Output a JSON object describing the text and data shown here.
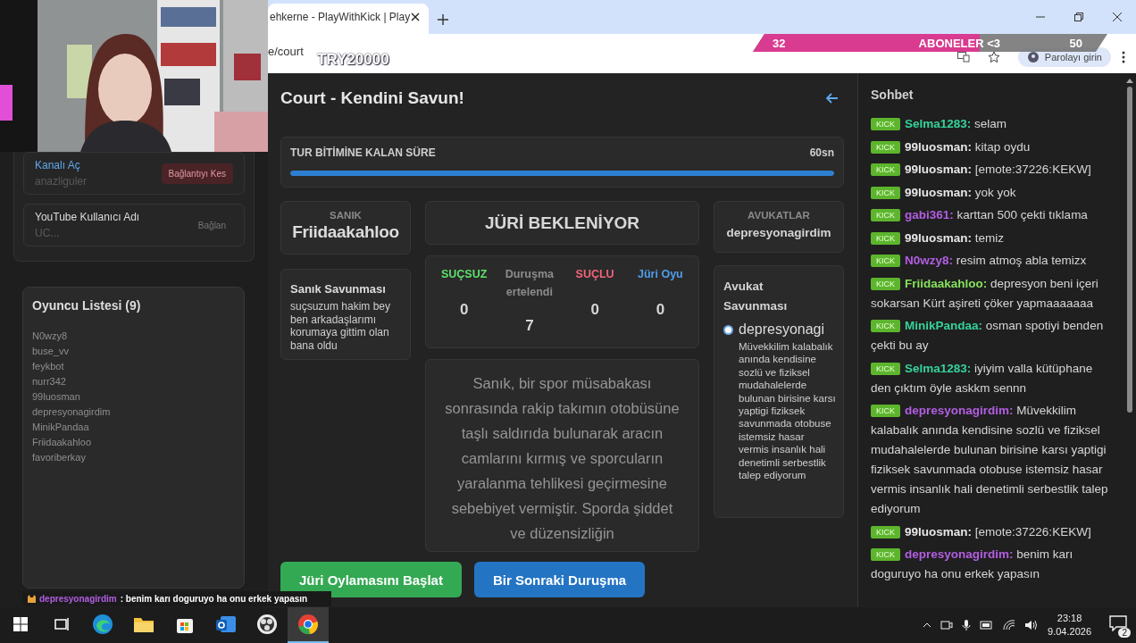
{
  "stream_overlay": {
    "goal": {
      "current": "32",
      "label": "ABONELER <3",
      "target": "50",
      "level": 0.64
    },
    "ticker_text": "TRY20000",
    "chat_toast": {
      "user": "depresyonagirdim",
      "text": ": benim karı doguruyo ha onu erkek yapasın"
    }
  },
  "browser": {
    "tab_title": "ehkerne - PlayWithKick | Play",
    "address": "e/court",
    "password_chip": "Parolayı girin"
  },
  "sidebar": {
    "accounts": [
      {
        "title": "Kanalı Aç",
        "kind": "link",
        "value": "anazliguler",
        "action": "Bağlantıyı Kes",
        "connected": true
      },
      {
        "title": "YouTube Kullanıcı Adı",
        "kind": "label",
        "value": "UC...",
        "action": "Bağlan",
        "connected": false
      }
    ],
    "players": {
      "title": "Oyuncu Listesi (9)",
      "names": [
        "N0wzy8",
        "buse_vv",
        "feykbot",
        "nurr342",
        "99luosman",
        "depresyonagirdim",
        "MinikPandaa",
        "Friidaakahloo",
        "favoriberkay"
      ]
    }
  },
  "court": {
    "title": "Court - Kendini Savun!",
    "timer": {
      "label": "TUR BİTİMİNE KALAN SÜRE",
      "value": "60sn",
      "level": 1
    },
    "defendant": {
      "label": "SANIK",
      "name": "Friidaakahloo"
    },
    "defendant_defense": {
      "title": "Sanık Savunması",
      "text": "suçsuzum hakim bey ben arkadaşlarımı korumaya gittim olan bana oldu"
    },
    "status": "JÜRİ BEKLENİYOR",
    "votes": [
      {
        "label": "SUÇSUZ",
        "count": "0",
        "color": "#5ee06a"
      },
      {
        "label": "Duruşma ertelendi",
        "count": "7",
        "color": "#8c8c8c"
      },
      {
        "label": "SUÇLU",
        "count": "0",
        "color": "#f2647a"
      },
      {
        "label": "Jüri Oyu",
        "count": "0",
        "color": "#4f9fea"
      }
    ],
    "case_text": "Sanık, bir spor müsabakası sonrasında rakip takımın otobüsüne taşlı saldırıda bulunarak aracın camlarını kırmış ve sporcuların yaralanma tehlikesi geçirmesine sebebiyet vermiştir. Sporda şiddet ve düzensizliğin",
    "lawyers": {
      "label": "AVUKATLAR",
      "name": "depresyonagirdim"
    },
    "lawyer_defense": {
      "title": "Avukat Savunması",
      "entries": [
        {
          "name": "depresyonagi",
          "text": "Müvekkilim kalabalık anında kendisine sozlü ve fiziksel mudahalelerde bulunan birisine karsı yaptigi fiziksek savunmada otobuse istemsiz hasar vermis insanlık hali denetimli serbestlik talep ediyorum",
          "selected": true
        }
      ]
    },
    "buttons": [
      {
        "label": "Jüri Oylamasını Başlat",
        "kind": "green"
      },
      {
        "label": "Bir Sonraki Duruşma",
        "kind": "blue"
      }
    ]
  },
  "chat": {
    "title": "Sohbet",
    "messages": [
      {
        "badge": "KICK",
        "user": "Selma1283:",
        "color": "#35d39a",
        "text": "selam"
      },
      {
        "badge": "KICK",
        "user": "99luosman:",
        "color": "#e6e6e6",
        "text": "kitap oydu"
      },
      {
        "badge": "KICK",
        "user": "99luosman:",
        "color": "#e6e6e6",
        "text": "[emote:37226:KEKW]"
      },
      {
        "badge": "KICK",
        "user": "99luosman:",
        "color": "#e6e6e6",
        "text": "yok yok"
      },
      {
        "badge": "KICK",
        "user": "gabi361:",
        "color": "#b35ee3",
        "text": "karttan 500 çekti tıklama"
      },
      {
        "badge": "KICK",
        "user": "99luosman:",
        "color": "#e6e6e6",
        "text": "temiz"
      },
      {
        "badge": "KICK",
        "user": "N0wzy8:",
        "color": "#b35ee3",
        "text": "resim atmoş abla temizx"
      },
      {
        "badge": "KICK",
        "user": "Friidaakahloo:",
        "color": "#86e05c",
        "text": "depresyon beni içeri sokarsan Kürt aşireti çöker yapmaaaaaaa"
      },
      {
        "badge": "KICK",
        "user": "MinikPandaa:",
        "color": "#35d39a",
        "text": "osman spotiyi benden çekti bu ay"
      },
      {
        "badge": "KICK",
        "user": "Selma1283:",
        "color": "#35d39a",
        "text": "iyiyim valla kütüphane den çıktım öyle askkm sennn"
      },
      {
        "badge": "KICK",
        "user": "depresyonagirdim:",
        "color": "#b35ee3",
        "text": "Müvekkilim kalabalık anında kendisine sozlü ve fiziksel mudahalelerde bulunan birisine karsı yaptigi fiziksek savunmada otobuse istemsiz hasar vermis insanlık hali denetimli serbestlik talep ediyorum"
      },
      {
        "badge": "KICK",
        "user": "99luosman:",
        "color": "#e6e6e6",
        "text": "[emote:37226:KEKW]"
      },
      {
        "badge": "KICK",
        "user": "depresyonagirdim:",
        "color": "#b35ee3",
        "text": "benim karı doguruyo ha onu erkek yapasın"
      }
    ]
  },
  "taskbar": {
    "apps": [
      {
        "kind": "start",
        "active": false
      },
      {
        "kind": "taskview",
        "active": false
      },
      {
        "kind": "edge",
        "active": false
      },
      {
        "kind": "explorer",
        "active": false
      },
      {
        "kind": "store",
        "active": false
      },
      {
        "kind": "mail",
        "active": false
      },
      {
        "kind": "obs",
        "active": false
      },
      {
        "kind": "chrome",
        "active": true
      }
    ],
    "time": "23:18",
    "date": "9.04.2026",
    "notifications": "2"
  }
}
